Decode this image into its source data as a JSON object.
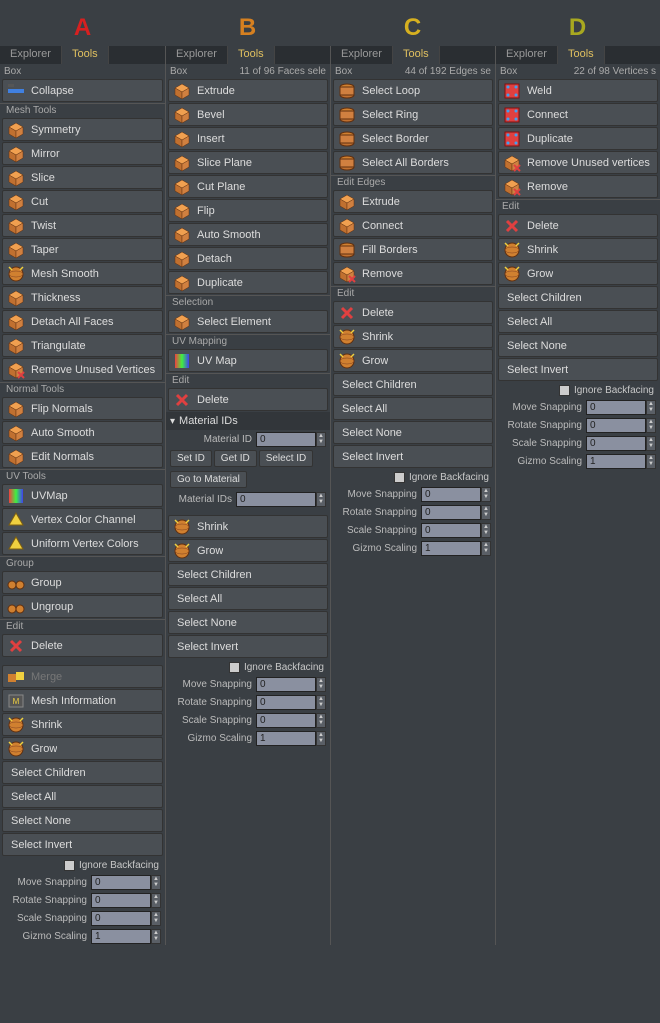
{
  "headers": [
    "A",
    "B",
    "C",
    "D"
  ],
  "tabs": {
    "explorer": "Explorer",
    "tools": "Tools"
  },
  "panelA": {
    "status_left": "Box",
    "tools_top": [
      {
        "id": "collapse",
        "label": "Collapse",
        "icon": "collapse"
      }
    ],
    "mesh_tools_hdr": "Mesh Tools",
    "mesh_tools": [
      {
        "id": "symmetry",
        "label": "Symmetry",
        "icon": "symmetry"
      },
      {
        "id": "mirror",
        "label": "Mirror",
        "icon": "mirror"
      },
      {
        "id": "slice",
        "label": "Slice",
        "icon": "slice"
      },
      {
        "id": "cut",
        "label": "Cut",
        "icon": "cut"
      },
      {
        "id": "twist",
        "label": "Twist",
        "icon": "twist"
      },
      {
        "id": "taper",
        "label": "Taper",
        "icon": "taper"
      },
      {
        "id": "mesh-smooth",
        "label": "Mesh Smooth",
        "icon": "sphere"
      },
      {
        "id": "thickness",
        "label": "Thickness",
        "icon": "thickness"
      },
      {
        "id": "detach-all-faces",
        "label": "Detach All Faces",
        "icon": "detach-all"
      },
      {
        "id": "triangulate",
        "label": "Triangulate",
        "icon": "triangulate"
      },
      {
        "id": "remove-unused-vertices",
        "label": "Remove Unused Vertices",
        "icon": "remove-verts"
      }
    ],
    "normal_tools_hdr": "Normal Tools",
    "normal_tools": [
      {
        "id": "flip-normals",
        "label": "Flip Normals",
        "icon": "flip-n"
      },
      {
        "id": "auto-smooth",
        "label": "Auto Smooth",
        "icon": "auto-smooth"
      },
      {
        "id": "edit-normals",
        "label": "Edit Normals",
        "icon": "edit-n"
      }
    ],
    "uv_tools_hdr": "UV Tools",
    "uv_tools": [
      {
        "id": "uvmap",
        "label": "UVMap",
        "icon": "uvmap"
      },
      {
        "id": "vertex-color-channel",
        "label": "Vertex Color Channel",
        "icon": "vcc"
      },
      {
        "id": "uniform-vertex-colors",
        "label": "Uniform Vertex Colors",
        "icon": "uvc"
      }
    ],
    "group_hdr": "Group",
    "group_tools": [
      {
        "id": "group",
        "label": "Group",
        "icon": "group"
      },
      {
        "id": "ungroup",
        "label": "Ungroup",
        "icon": "ungroup"
      }
    ],
    "edit_hdr": "Edit",
    "edit_tools": [
      {
        "id": "delete",
        "label": "Delete",
        "icon": "delete"
      }
    ],
    "extra_tools": [
      {
        "id": "merge",
        "label": "Merge",
        "icon": "merge",
        "disabled": true
      },
      {
        "id": "mesh-information",
        "label": "Mesh Information",
        "icon": "mesh-info"
      },
      {
        "id": "shrink",
        "label": "Shrink",
        "icon": "shrink"
      },
      {
        "id": "grow",
        "label": "Grow",
        "icon": "grow"
      }
    ],
    "select_tools": [
      {
        "id": "select-children",
        "label": "Select Children"
      },
      {
        "id": "select-all",
        "label": "Select All"
      },
      {
        "id": "select-none",
        "label": "Select None"
      },
      {
        "id": "select-invert",
        "label": "Select Invert"
      }
    ]
  },
  "panelB": {
    "status_left": "Box",
    "status_right": "11 of 96 Faces sele",
    "tools": [
      {
        "id": "extrude",
        "label": "Extrude",
        "icon": "extrude"
      },
      {
        "id": "bevel",
        "label": "Bevel",
        "icon": "bevel"
      },
      {
        "id": "insert",
        "label": "Insert",
        "icon": "insert"
      },
      {
        "id": "slice-plane",
        "label": "Slice Plane",
        "icon": "slice-plane"
      },
      {
        "id": "cut-plane",
        "label": "Cut Plane",
        "icon": "cut-plane"
      },
      {
        "id": "flip",
        "label": "Flip",
        "icon": "flip"
      },
      {
        "id": "auto-smooth",
        "label": "Auto Smooth",
        "icon": "auto-smooth"
      },
      {
        "id": "detach",
        "label": "Detach",
        "icon": "detach"
      },
      {
        "id": "duplicate",
        "label": "Duplicate",
        "icon": "duplicate"
      }
    ],
    "selection_hdr": "Selection",
    "selection_tools": [
      {
        "id": "select-element",
        "label": "Select Element",
        "icon": "select-el"
      }
    ],
    "uvmapping_hdr": "UV Mapping",
    "uvmapping_tools": [
      {
        "id": "uv-map",
        "label": "UV Map",
        "icon": "uvmap"
      }
    ],
    "edit_hdr": "Edit",
    "edit_tools": [
      {
        "id": "delete",
        "label": "Delete",
        "icon": "delete"
      }
    ],
    "material_ids_hdr": "Material IDs",
    "material_id_label": "Material ID",
    "material_id_value": "0",
    "set_id": "Set ID",
    "get_id": "Get ID",
    "select_id": "Select ID",
    "go_to_material": "Go to Material",
    "material_ids_label": "Material IDs",
    "material_ids_value": "0",
    "bottom_tools": [
      {
        "id": "shrink",
        "label": "Shrink",
        "icon": "shrink"
      },
      {
        "id": "grow",
        "label": "Grow",
        "icon": "grow"
      }
    ],
    "select_tools": [
      {
        "id": "select-children",
        "label": "Select Children"
      },
      {
        "id": "select-all",
        "label": "Select All"
      },
      {
        "id": "select-none",
        "label": "Select None"
      },
      {
        "id": "select-invert",
        "label": "Select Invert"
      }
    ]
  },
  "panelC": {
    "status_left": "Box",
    "status_right": "44 of 192 Edges se",
    "tools": [
      {
        "id": "select-loop",
        "label": "Select Loop",
        "icon": "loop"
      },
      {
        "id": "select-ring",
        "label": "Select Ring",
        "icon": "ring"
      },
      {
        "id": "select-border",
        "label": "Select Border",
        "icon": "border"
      },
      {
        "id": "select-all-borders",
        "label": "Select All Borders",
        "icon": "all-borders"
      }
    ],
    "edit_edges_hdr": "Edit Edges",
    "edit_edges": [
      {
        "id": "extrude",
        "label": "Extrude",
        "icon": "extrude-e"
      },
      {
        "id": "connect",
        "label": "Connect",
        "icon": "connect-e"
      },
      {
        "id": "fill-borders",
        "label": "Fill Borders",
        "icon": "fill"
      },
      {
        "id": "remove",
        "label": "Remove",
        "icon": "remove"
      }
    ],
    "edit_hdr": "Edit",
    "edit_tools": [
      {
        "id": "delete",
        "label": "Delete",
        "icon": "delete"
      },
      {
        "id": "shrink",
        "label": "Shrink",
        "icon": "shrink"
      },
      {
        "id": "grow",
        "label": "Grow",
        "icon": "grow"
      }
    ],
    "select_tools": [
      {
        "id": "select-children",
        "label": "Select Children"
      },
      {
        "id": "select-all",
        "label": "Select All"
      },
      {
        "id": "select-none",
        "label": "Select None"
      },
      {
        "id": "select-invert",
        "label": "Select Invert"
      }
    ]
  },
  "panelD": {
    "status_left": "Box",
    "status_right": "22 of 98 Vertices s",
    "tools": [
      {
        "id": "weld",
        "label": "Weld",
        "icon": "weld"
      },
      {
        "id": "connect",
        "label": "Connect",
        "icon": "connect-v"
      },
      {
        "id": "duplicate",
        "label": "Duplicate",
        "icon": "dup-v"
      },
      {
        "id": "remove-unused-vertices",
        "label": "Remove Unused vertices",
        "icon": "remove-verts"
      },
      {
        "id": "remove",
        "label": "Remove",
        "icon": "remove"
      }
    ],
    "edit_hdr": "Edit",
    "edit_tools": [
      {
        "id": "delete",
        "label": "Delete",
        "icon": "delete"
      },
      {
        "id": "shrink",
        "label": "Shrink",
        "icon": "shrink"
      },
      {
        "id": "grow",
        "label": "Grow",
        "icon": "grow"
      }
    ],
    "select_tools": [
      {
        "id": "select-children",
        "label": "Select Children"
      },
      {
        "id": "select-all",
        "label": "Select All"
      },
      {
        "id": "select-none",
        "label": "Select None"
      },
      {
        "id": "select-invert",
        "label": "Select Invert"
      }
    ]
  },
  "snapping": {
    "ignore_backfacing": "Ignore Backfacing",
    "move": "Move Snapping",
    "rotate": "Rotate Snapping",
    "scale": "Scale Snapping",
    "gizmo": "Gizmo Scaling",
    "move_val": "0",
    "rotate_val": "0",
    "scale_val": "0",
    "gizmo_val": "1"
  }
}
